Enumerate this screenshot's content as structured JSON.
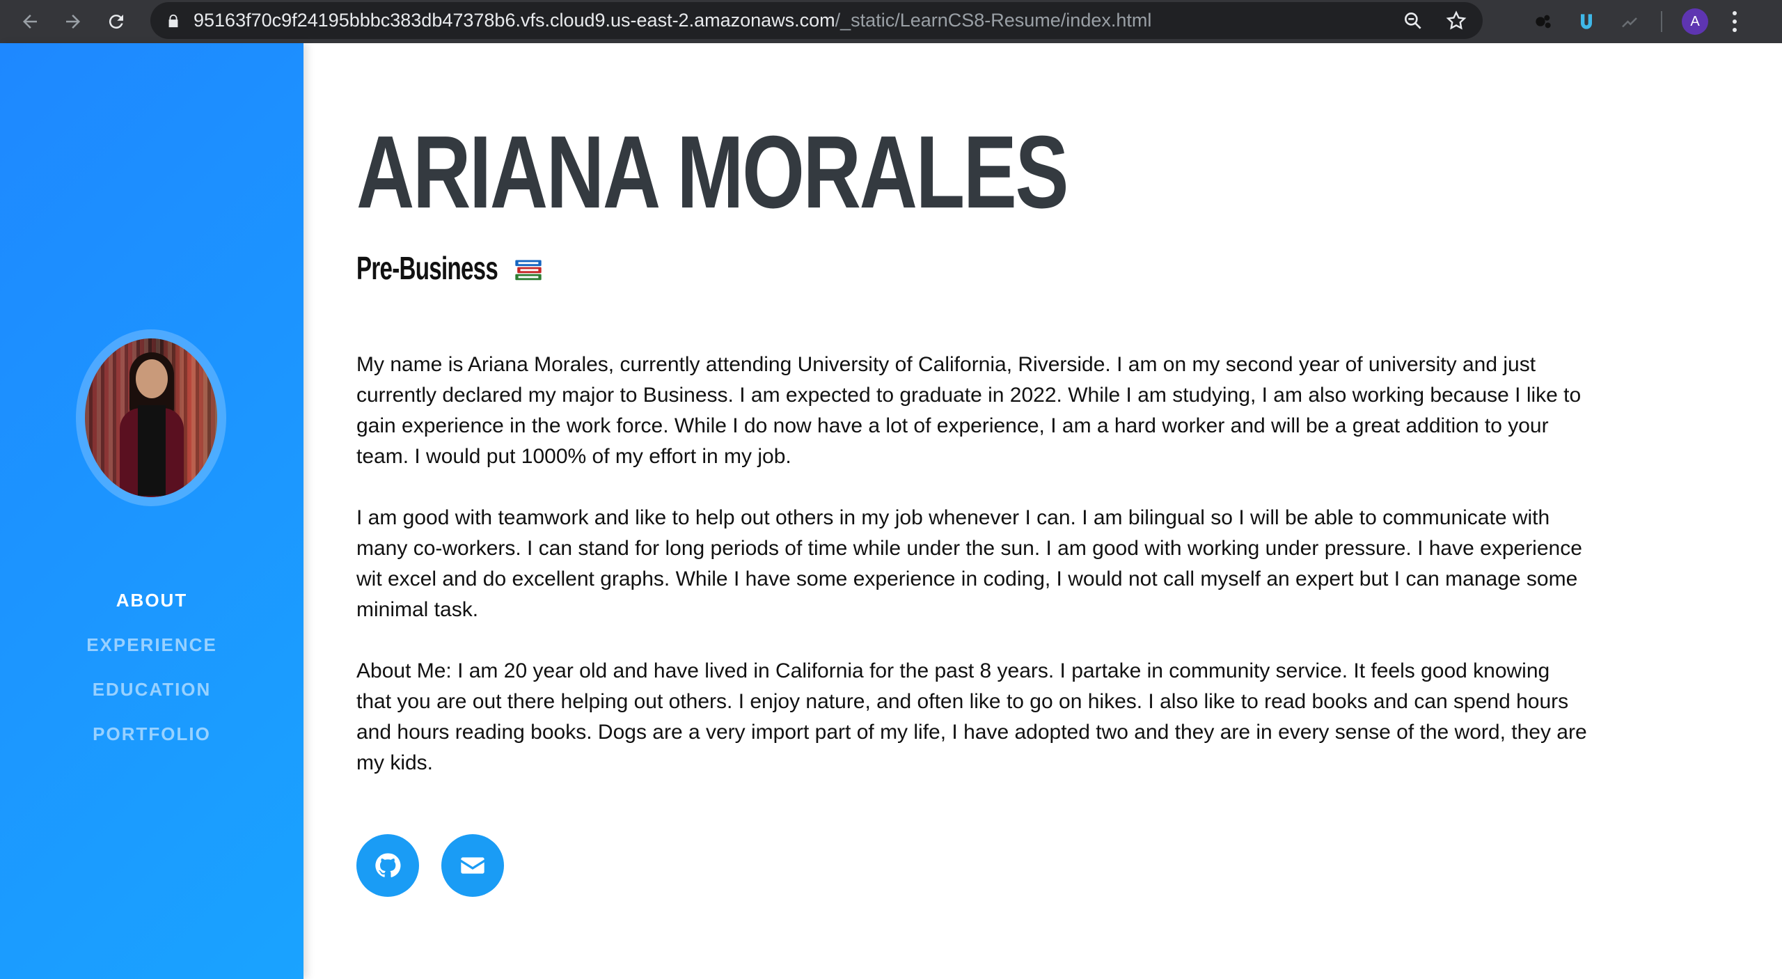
{
  "browser": {
    "url_host": "95163f70c9f24195bbbc383db47378b6.vfs.cloud9.us-east-2.amazonaws.com",
    "url_path": "/_static/LearnCS8-Resume/index.html",
    "profile_initial": "A"
  },
  "sidebar": {
    "nav": [
      {
        "label": "About",
        "active": true
      },
      {
        "label": "Experience",
        "active": false
      },
      {
        "label": "Education",
        "active": false
      },
      {
        "label": "Portfolio",
        "active": false
      }
    ]
  },
  "main": {
    "name": "ARIANA MORALES",
    "subtitle": "Pre-Business",
    "paragraphs": [
      "My name is Ariana Morales, currently attending University of California, Riverside. I am on my second year of university and just currently declared my major to Business. I am expected to graduate in 2022. While I am studying, I am also working because I like to gain experience in the work force. While I do now have a lot of experience, I am a hard worker and will be a great addition to your team. I would put 1000% of my effort in my job.",
      "I am good with teamwork and like to help out others in my job whenever I can. I am bilingual so I will be able to communicate with many co-workers. I can stand for long periods of time while under the sun. I am good with working under pressure. I have experience wit excel and do excellent graphs. While I have some experience in coding, I would not call myself an expert but I can manage some minimal task.",
      "About Me: I am 20 year old and have lived in California for the past 8 years. I partake in community service. It feels good knowing that you are out there helping out others. I enjoy nature, and often like to go on hikes. I also like to read books and can spend hours and hours reading books. Dogs are a very import part of my life, I have adopted two and they are in every sense of the word, they are my kids."
    ]
  },
  "social": [
    {
      "icon": "github-icon"
    },
    {
      "icon": "envelope-icon"
    }
  ],
  "colors": {
    "sidebar_start": "#1e88ff",
    "sidebar_end": "#1aa3ff",
    "name_color": "#343a40",
    "social_button": "#1a9cf5",
    "chrome_bg": "#35363a"
  }
}
